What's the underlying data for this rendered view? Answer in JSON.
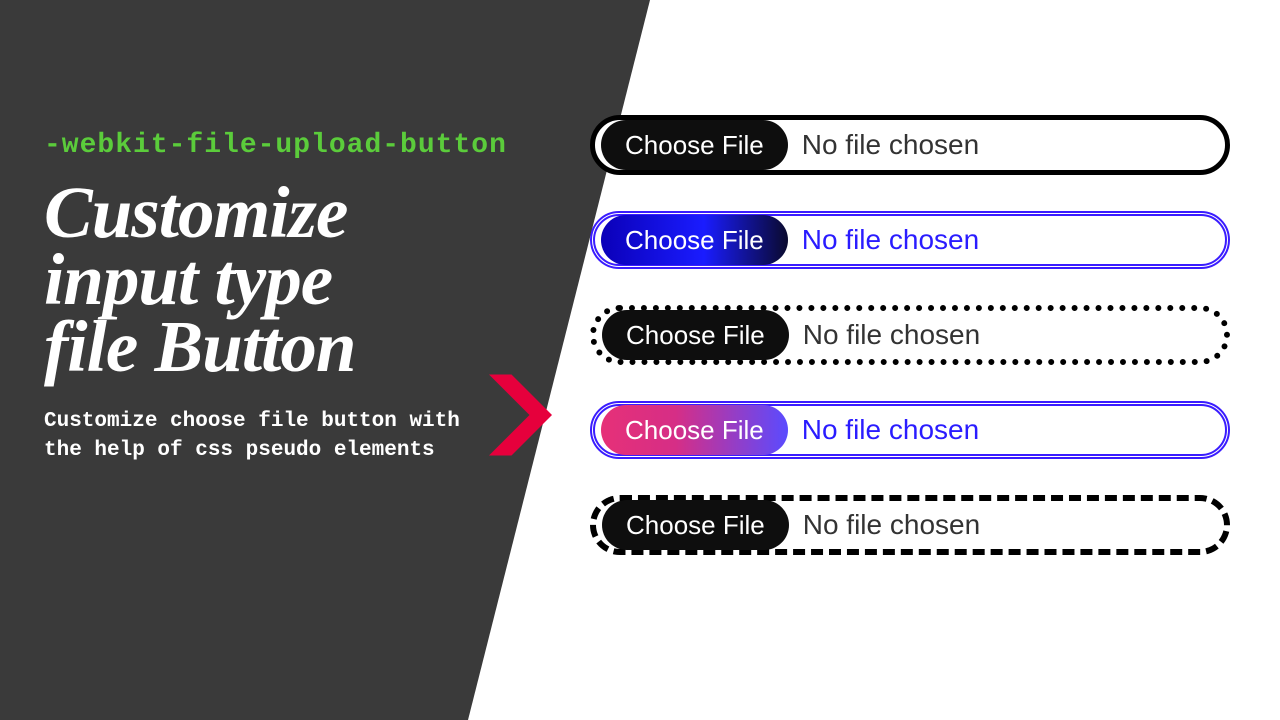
{
  "left": {
    "subtitle": "-webkit-file-upload-button",
    "title_line1": "Customize",
    "title_line2": "input type",
    "title_line3": "file Button",
    "description": "Customize choose file button with the help of css pseudo elements"
  },
  "inputs": {
    "row1": {
      "button_label": "Choose File",
      "status": "No file chosen"
    },
    "row2": {
      "button_label": "Choose File",
      "status": "No file chosen"
    },
    "row3": {
      "button_label": "Choose File",
      "status": "No file chosen"
    },
    "row4": {
      "button_label": "Choose File",
      "status": "No file chosen"
    },
    "row5": {
      "button_label": "Choose File",
      "status": "No file chosen"
    }
  },
  "colors": {
    "panel_bg": "#3a3a3a",
    "accent_green": "#5bcc3b",
    "accent_red": "#e6003c",
    "accent_blue": "#3a1cff"
  }
}
